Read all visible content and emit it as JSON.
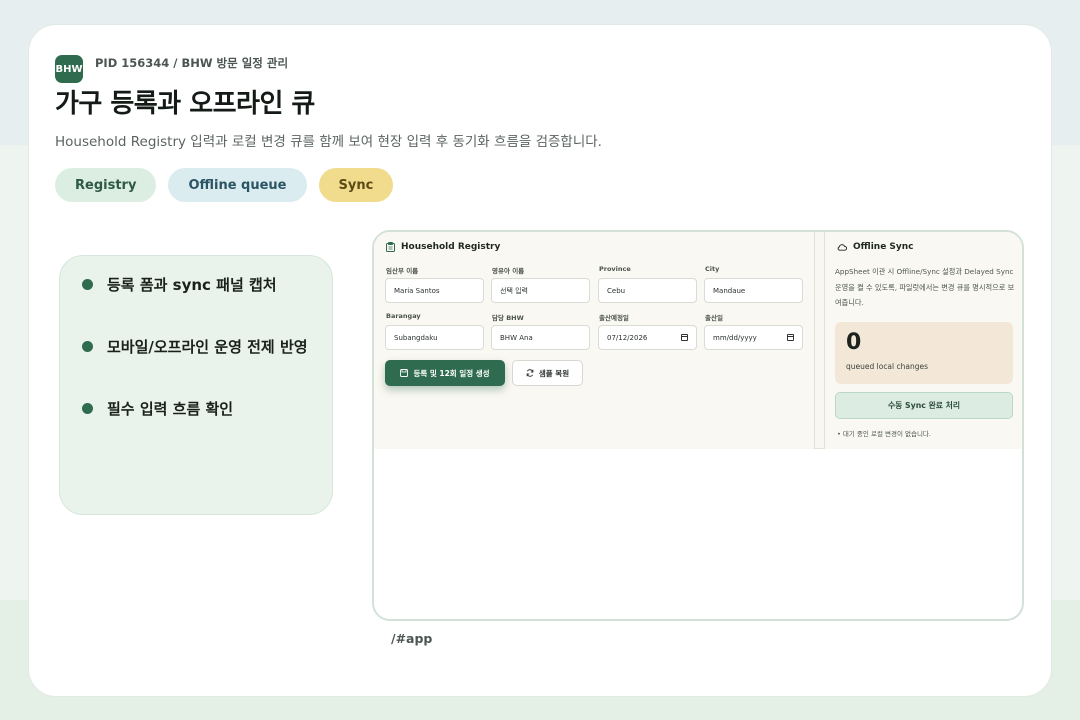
{
  "header": {
    "logo_text": "BHW",
    "pid": "PID 156344 / BHW 방문 일정 관리",
    "title": "가구 등록과 오프라인 큐",
    "subtitle": "Household Registry 입력과 로컬 변경 큐를 함께 보여 현장 입력 후 동기화 흐름을 검증합니다."
  },
  "chips": [
    {
      "label": "Registry"
    },
    {
      "label": "Offline queue"
    },
    {
      "label": "Sync"
    }
  ],
  "features": [
    {
      "label": "등록 폼과 sync 패널 캡처"
    },
    {
      "label": "모바일/오프라인 운영 전제 반영"
    },
    {
      "label": "필수 입력 흐름 확인"
    }
  ],
  "registry": {
    "title": "Household Registry",
    "fields": [
      {
        "label": "임산부 이름",
        "value": "Maria Santos"
      },
      {
        "label": "영유아 이름",
        "value": "선택 입력"
      },
      {
        "label": "Province",
        "value": "Cebu"
      },
      {
        "label": "City",
        "value": "Mandaue"
      },
      {
        "label": "Barangay",
        "value": "Subangdaku"
      },
      {
        "label": "담당 BHW",
        "value": "BHW Ana"
      },
      {
        "label": "출산예정일",
        "value": "07/12/2026"
      },
      {
        "label": "출산일",
        "value": "mm/dd/yyyy"
      }
    ],
    "primary_button": "등록 및 12회 일정 생성",
    "secondary_button": "샘플 복원"
  },
  "sync": {
    "title": "Offline Sync",
    "description": "AppSheet 이관 시 Offline/Sync 설정과 Delayed Sync 운영을 켤 수 있도록, 파일럿에서는 변경 큐를 명시적으로 보여줍니다.",
    "queue_count": "0",
    "queue_label": "queued local changes",
    "button": "수동 Sync 완료 처리",
    "note": "대기 중인 로컬 변경이 없습니다."
  },
  "route": "/#app",
  "colors": {
    "brand": "#2f6b4f",
    "chip_registry": "#dceee2",
    "chip_queue": "#daecef",
    "chip_sync": "#f1dc8e",
    "queue_box": "#f3e8d8"
  }
}
